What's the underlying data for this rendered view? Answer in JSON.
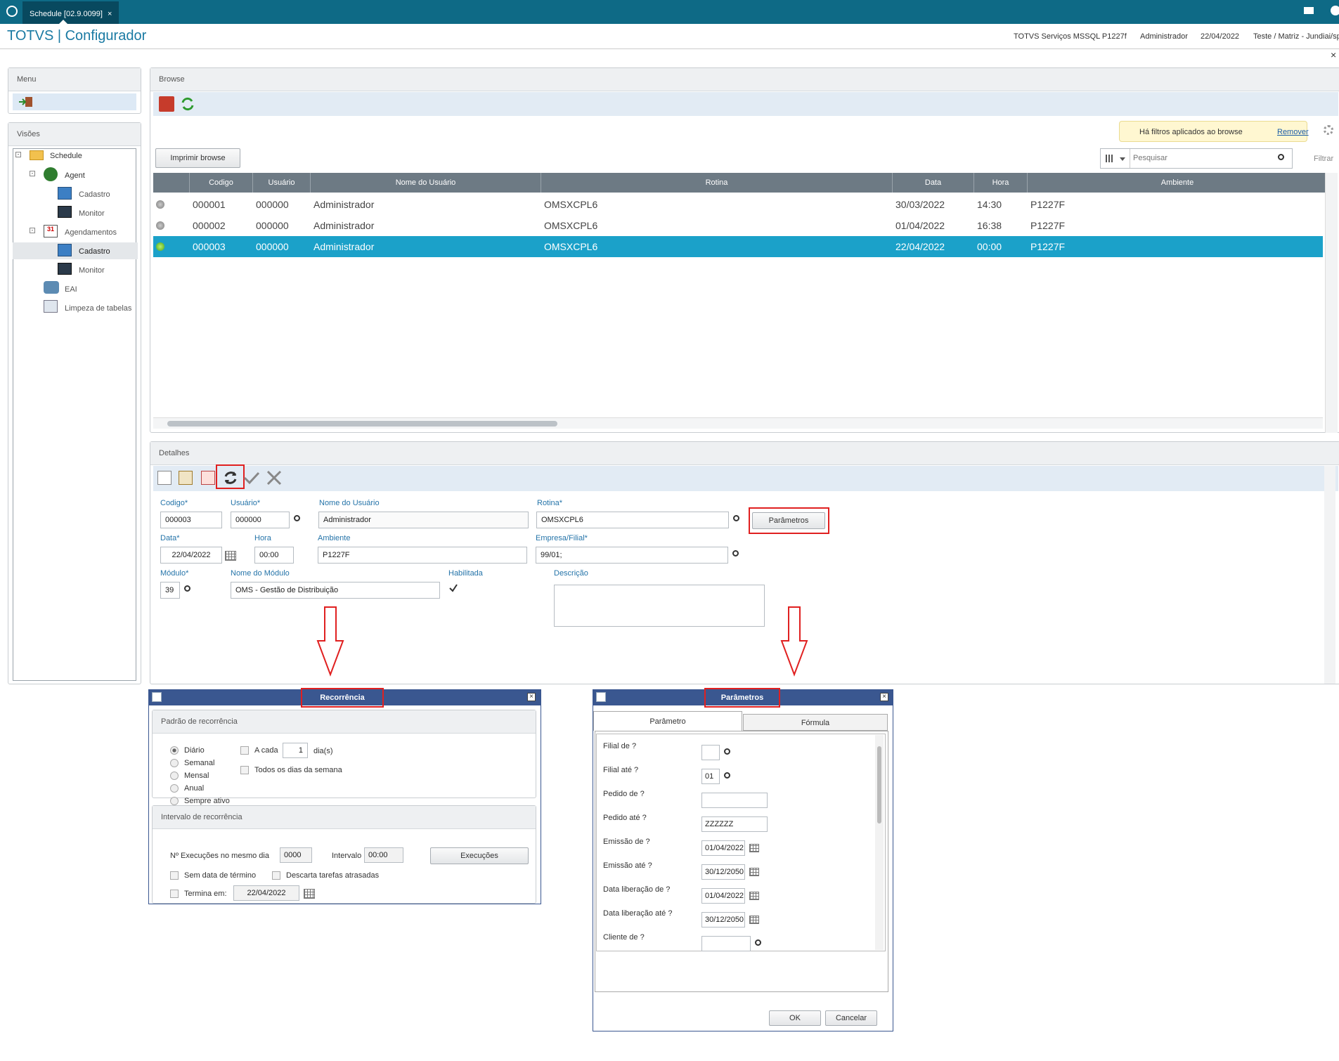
{
  "window": {
    "tab_label": "Schedule [02.9.0099]",
    "close_tab": "×"
  },
  "header": {
    "app_title": "TOTVS | Configurador",
    "server": "TOTVS Serviços MSSQL P1227f",
    "user": "Administrador",
    "date": "22/04/2022",
    "company": "Teste / Matriz - Jundiai/sp",
    "close": "×"
  },
  "menu": {
    "title": "Menu"
  },
  "visoes": {
    "title": "Visões",
    "tree": [
      {
        "label": "Schedule"
      },
      {
        "label": "Agent"
      },
      {
        "label": "Cadastro"
      },
      {
        "label": "Monitor"
      },
      {
        "label": "Agendamentos"
      },
      {
        "label": "Cadastro"
      },
      {
        "label": "Monitor"
      },
      {
        "label": "EAI"
      },
      {
        "label": "Limpeza de tabelas"
      }
    ]
  },
  "browse": {
    "title": "Browse",
    "filter_notice": "Há filtros aplicados ao browse",
    "filter_remove": "Remover",
    "print_button": "Imprimir browse",
    "search_placeholder": "Pesquisar",
    "filter_label": "Filtrar",
    "columns": [
      "Codigo",
      "Usuário",
      "Nome do Usuário",
      "Rotina",
      "Data",
      "Hora",
      "Ambiente"
    ],
    "rows": [
      {
        "status": "gray",
        "codigo": "000001",
        "usuario": "000000",
        "nome": "Administrador",
        "rotina": "OMSXCPL6",
        "data": "30/03/2022",
        "hora": "14:30",
        "ambiente": "P1227F"
      },
      {
        "status": "gray",
        "codigo": "000002",
        "usuario": "000000",
        "nome": "Administrador",
        "rotina": "OMSXCPL6",
        "data": "01/04/2022",
        "hora": "16:38",
        "ambiente": "P1227F"
      },
      {
        "status": "green",
        "codigo": "000003",
        "usuario": "000000",
        "nome": "Administrador",
        "rotina": "OMSXCPL6",
        "data": "22/04/2022",
        "hora": "00:00",
        "ambiente": "P1227F"
      }
    ]
  },
  "detalhes": {
    "title": "Detalhes",
    "codigo_label": "Codigo*",
    "codigo": "000003",
    "usuario_label": "Usuário*",
    "usuario": "000000",
    "nome_usuario_label": "Nome do Usuário",
    "nome_usuario": "Administrador",
    "rotina_label": "Rotina*",
    "rotina": "OMSXCPL6",
    "parametros_button": "Parâmetros",
    "data_label": "Data*",
    "data": "22/04/2022",
    "hora_label": "Hora",
    "hora": "00:00",
    "ambiente_label": "Ambiente",
    "ambiente": "P1227F",
    "empresa_label": "Empresa/Filial*",
    "empresa": "99/01;",
    "modulo_label": "Módulo*",
    "modulo": "39",
    "nome_modulo_label": "Nome do Módulo",
    "nome_modulo": "OMS - Gestão de Distribuição",
    "habilitada_label": "Habilitada",
    "descricao_label": "Descrição"
  },
  "recorrencia": {
    "title": "Recorrência",
    "padrao_title": "Padrão de recorrência",
    "options": [
      "Diário",
      "Semanal",
      "Mensal",
      "Anual",
      "Sempre ativo"
    ],
    "a_cada_label": "A cada",
    "a_cada_value": "1",
    "dias_label": "dia(s)",
    "todos_dias_label": "Todos os dias da semana",
    "intervalo_title": "Intervalo de recorrência",
    "execucoes_label": "Nº Execuções no mesmo dia",
    "execucoes_value": "0000",
    "intervalo_label": "Intervalo",
    "intervalo_value": "00:00",
    "execucoes_button": "Execuções",
    "sem_data_label": "Sem data de término",
    "descarta_label": "Descarta tarefas atrasadas",
    "termina_label": "Termina em:",
    "termina_value": "22/04/2022"
  },
  "parametros": {
    "title": "Parâmetros",
    "tab_parametro": "Parâmetro",
    "tab_formula": "Fórmula",
    "fields": [
      {
        "label": "Filial de ?",
        "value": ""
      },
      {
        "label": "Filial até ?",
        "value": "01"
      },
      {
        "label": "Pedido de ?",
        "value": ""
      },
      {
        "label": "Pedido até ?",
        "value": "ZZZZZZ"
      },
      {
        "label": "Emissão de ?",
        "value": "01/04/2022"
      },
      {
        "label": "Emissão até ?",
        "value": "30/12/2050"
      },
      {
        "label": "Data liberação de ?",
        "value": "01/04/2022"
      },
      {
        "label": "Data liberação até ?",
        "value": "30/12/2050"
      },
      {
        "label": "Cliente de ?",
        "value": ""
      }
    ],
    "ok_button": "OK",
    "cancel_button": "Cancelar"
  }
}
